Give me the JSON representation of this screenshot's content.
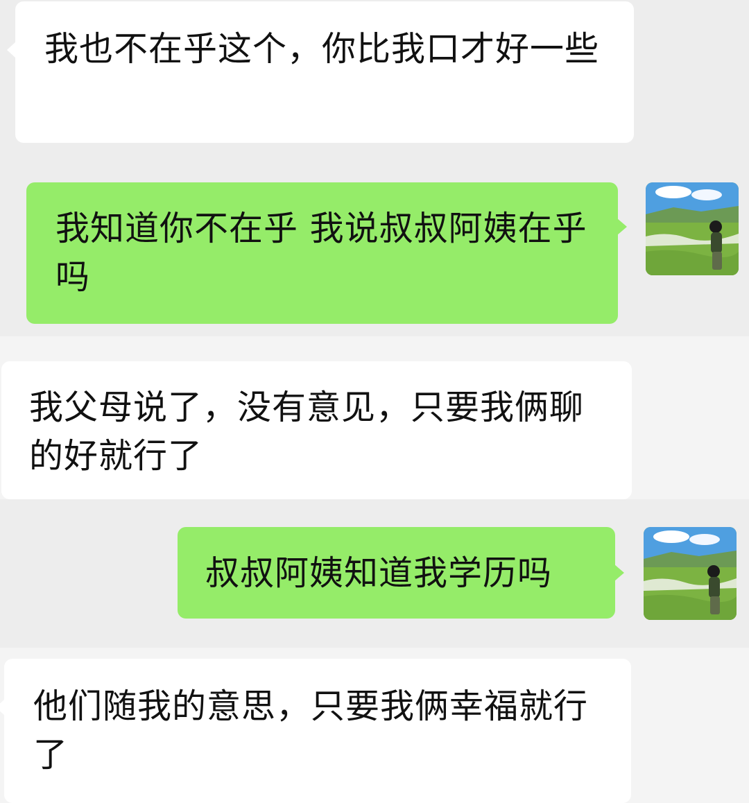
{
  "chat": {
    "messages": [
      {
        "sender": "other",
        "text": "我也不在乎这个，你比我口才好一些"
      },
      {
        "sender": "self",
        "text": "我知道你不在乎 我说叔叔阿姨在乎吗"
      },
      {
        "sender": "other",
        "text": "我父母说了，没有意见，只要我俩聊的好就行了"
      },
      {
        "sender": "self",
        "text": "叔叔阿姨知道我学历吗"
      },
      {
        "sender": "other",
        "text": "他们随我的意思，只要我俩幸福就行了"
      }
    ],
    "self_avatar_icon": "avatar-landscape-photo-icon",
    "colors": {
      "background": "#ededed",
      "incoming_bubble": "#ffffff",
      "outgoing_bubble": "#95ec69",
      "text": "#111111"
    }
  }
}
